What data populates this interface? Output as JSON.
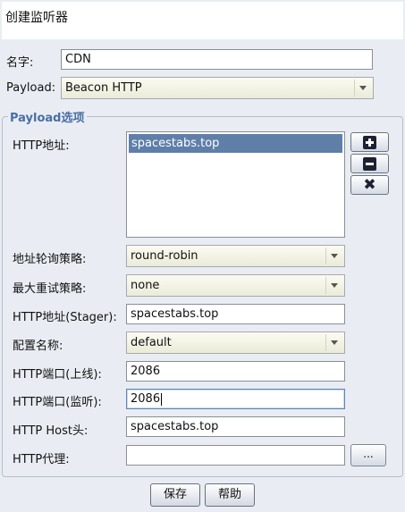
{
  "dialog": {
    "title": "创建监听器"
  },
  "name": {
    "label": "名字:",
    "value": "CDN"
  },
  "payload": {
    "label": "Payload:",
    "value": "Beacon HTTP"
  },
  "options": {
    "group_title": "Payload选项",
    "hosts": {
      "label": "HTTP地址:",
      "items": [
        "spacestabs.top"
      ]
    },
    "rotate": {
      "label": "地址轮询策略:",
      "value": "round-robin"
    },
    "retry": {
      "label": "最大重试策略:",
      "value": "none"
    },
    "stager_host": {
      "label": "HTTP地址(Stager):",
      "value": "spacestabs.top"
    },
    "profile": {
      "label": "配置名称:",
      "value": "default"
    },
    "port_c2": {
      "label": "HTTP端口(上线):",
      "value": "2086"
    },
    "port_bind": {
      "label": "HTTP端口(监听):",
      "value": "2086"
    },
    "host_header": {
      "label": "HTTP Host头:",
      "value": "spacestabs.top"
    },
    "proxy": {
      "label": "HTTP代理:",
      "value": "",
      "button_label": "..."
    }
  },
  "buttons": {
    "save": "保存",
    "help": "帮助"
  },
  "icons": {
    "add": "plus-icon",
    "remove": "minus-icon",
    "clear": "x-icon"
  }
}
